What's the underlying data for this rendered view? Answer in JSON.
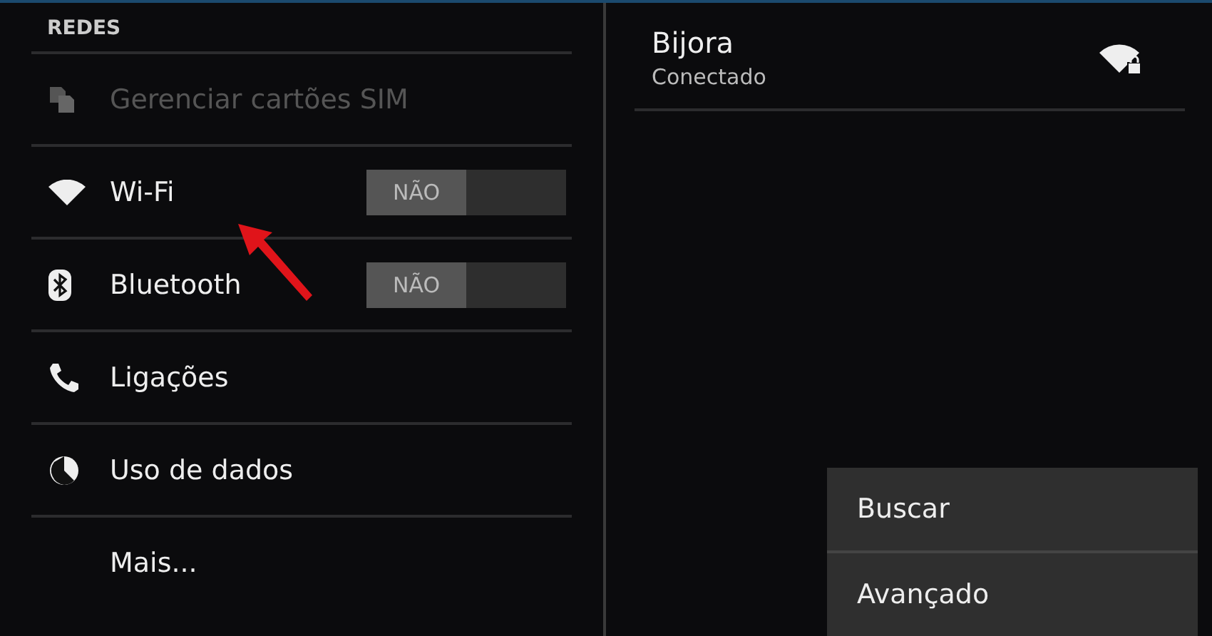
{
  "settings": {
    "section_header": "REDES",
    "items": [
      {
        "kind": "sim",
        "label": "Gerenciar cartões SIM",
        "disabled": true
      },
      {
        "kind": "wifi",
        "label": "Wi-Fi",
        "disabled": false,
        "toggle": {
          "on": false,
          "label": "NÃO"
        }
      },
      {
        "kind": "bluetooth",
        "label": "Bluetooth",
        "disabled": false,
        "toggle": {
          "on": false,
          "label": "NÃO"
        }
      },
      {
        "kind": "phone",
        "label": "Ligações",
        "disabled": false
      },
      {
        "kind": "data",
        "label": "Uso de dados",
        "disabled": false
      },
      {
        "kind": "none",
        "label": "Mais...",
        "disabled": false
      }
    ]
  },
  "networks": [
    {
      "name": "Bijora",
      "status": "Conectado"
    }
  ],
  "menu": [
    {
      "label": "Buscar"
    },
    {
      "label": "Avançado"
    }
  ]
}
